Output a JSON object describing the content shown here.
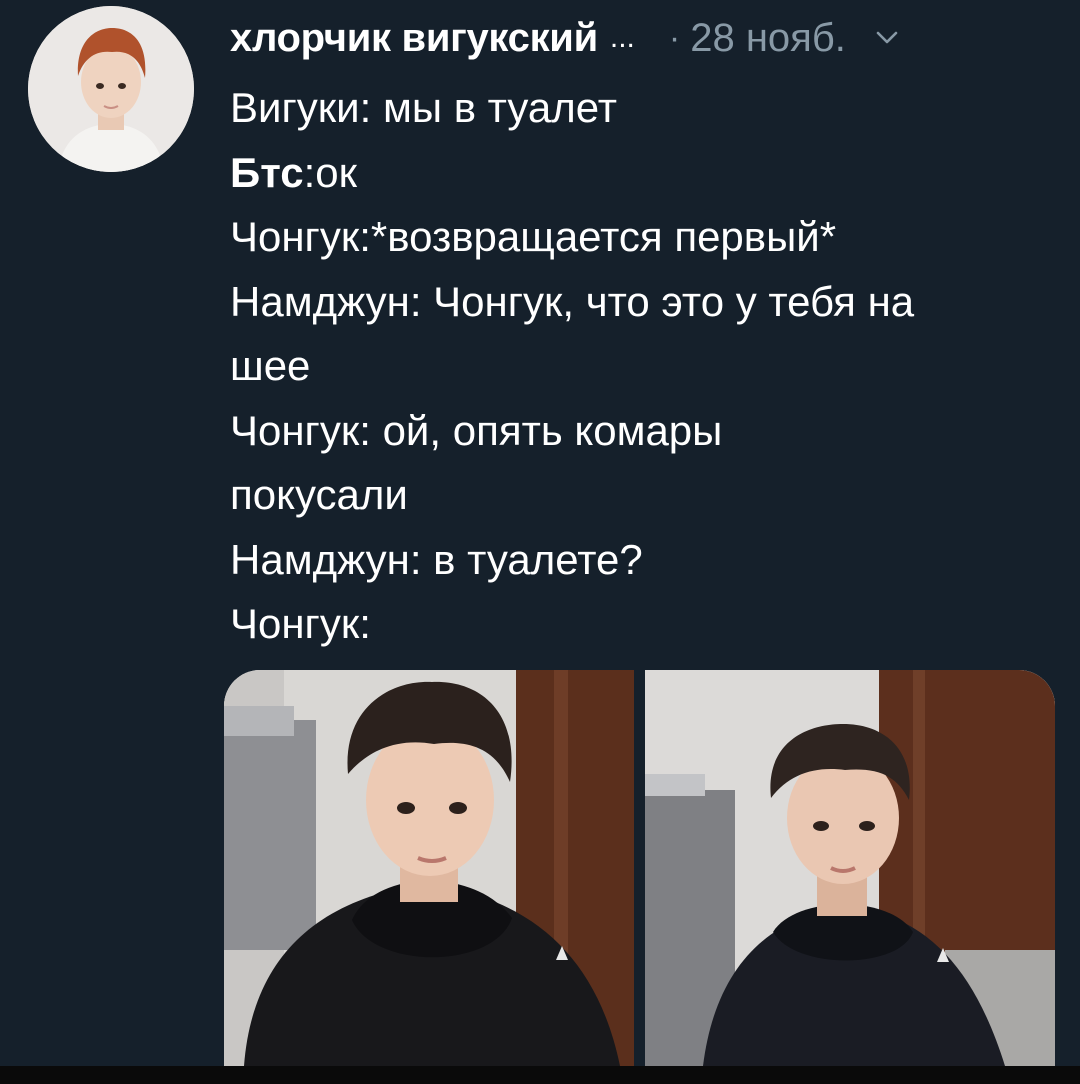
{
  "tweet": {
    "author_name": "хлорчик вигукский",
    "name_truncation": "...",
    "separator": "·",
    "date": "28 нояб.",
    "menu_icon": "chevron-down-icon",
    "avatar_icon": "profile-photo",
    "lines": [
      {
        "text": "Вигуки: мы в туалет"
      },
      {
        "bold_part": "Бтс",
        "text": ":ок"
      },
      {
        "text": "Чонгук:*возвращается первый*"
      },
      {
        "text": "Намджун: Чонгук, что это у тебя на"
      },
      {
        "text": "шее"
      },
      {
        "text": "Чонгук: ой, опять комары"
      },
      {
        "text": "покусали"
      },
      {
        "text": "Намджун: в туалете?"
      },
      {
        "text": "Чонгук:"
      }
    ],
    "media": [
      {
        "kind": "photo",
        "subject": "person-in-black-hoodie"
      },
      {
        "kind": "photo",
        "subject": "person-in-black-hoodie"
      }
    ]
  },
  "colors": {
    "background": "#15202b",
    "text": "#ffffff",
    "secondary_text": "#8899a6"
  }
}
